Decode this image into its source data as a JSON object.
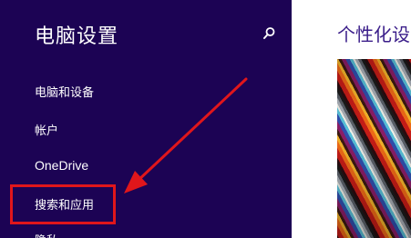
{
  "sidebar": {
    "title": "电脑设置",
    "search_icon": "search-icon",
    "items": [
      {
        "label": "电脑和设备"
      },
      {
        "label": "帐户"
      },
      {
        "label": "OneDrive"
      },
      {
        "label": "搜索和应用"
      },
      {
        "label": "隐私"
      }
    ]
  },
  "main": {
    "title": "个性化设置"
  },
  "colors": {
    "sidebar_bg": "#1c0354",
    "annotation_red": "#e0161b",
    "title_accent": "#3b1e8a"
  }
}
